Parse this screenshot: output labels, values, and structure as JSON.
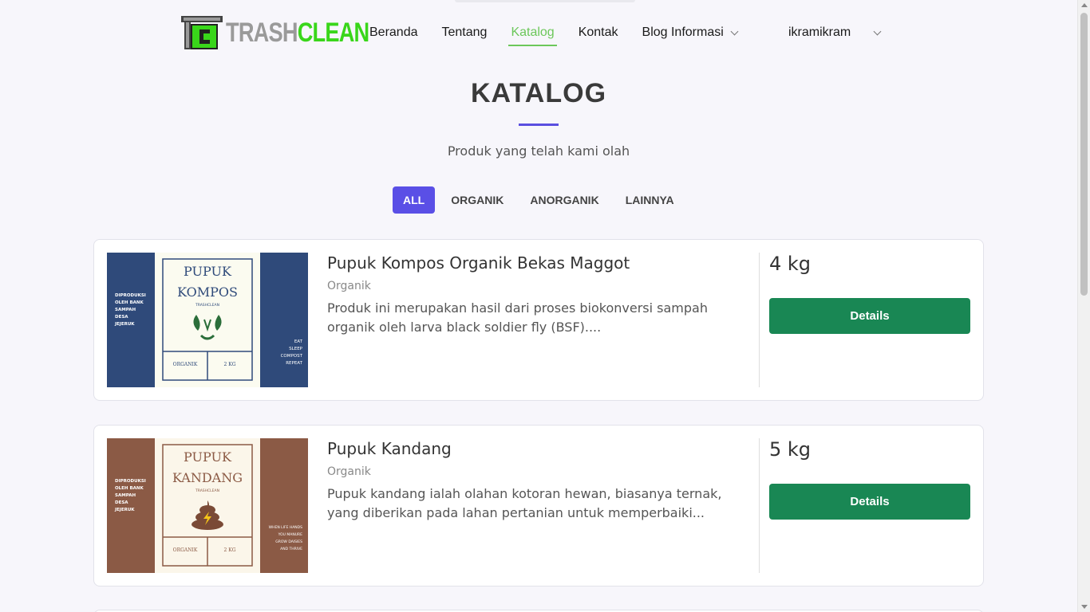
{
  "logo": {
    "text_part1": "TRASH",
    "text_part2": "CLEAN",
    "colors": {
      "part1": "#9a9a9a",
      "part2": "#39d61a"
    }
  },
  "nav": {
    "items": [
      {
        "label": "Beranda"
      },
      {
        "label": "Tentang"
      },
      {
        "label": "Katalog",
        "active": true
      },
      {
        "label": "Kontak"
      },
      {
        "label": "Blog Informasi",
        "dropdown": true
      }
    ],
    "user": {
      "name": "ikramikram"
    }
  },
  "page": {
    "title": "KATALOG",
    "subtitle": "Produk yang telah kami olah",
    "accent_color": "#5a4fe6"
  },
  "filters": [
    {
      "label": "ALL",
      "active": true
    },
    {
      "label": "ORGANIK"
    },
    {
      "label": "ANORGANIK"
    },
    {
      "label": "LAINNYA"
    }
  ],
  "products": [
    {
      "name": "Pupuk Kompos Organik Bekas Maggot",
      "category": "Organik",
      "description": "Produk ini merupakan hasil dari proses biokonversi sampah organik oleh larva black soldier fly (BSF)....",
      "weight": "4 kg",
      "button": "Details",
      "image": {
        "color": "#2f4a7a",
        "title1": "PUPUK",
        "title2": "KOMPOS",
        "brand": "TRASHCLEAN",
        "side_left": [
          "DIPRODUKSI",
          "OLEH BANK",
          "SAMPAH",
          "DESA",
          "JEJERUK"
        ],
        "side_right": [
          "EAT",
          "SLEEP",
          "COMPOST",
          "REPEAT"
        ],
        "footer_left": "ORGANIK",
        "footer_right": "2 KG",
        "icon": "leaf-recycle-icon"
      }
    },
    {
      "name": "Pupuk Kandang",
      "category": "Organik",
      "description": "Pupuk kandang ialah olahan kotoran hewan, biasanya ternak, yang diberikan pada lahan pertanian untuk memperbaiki...",
      "weight": "5 kg",
      "button": "Details",
      "image": {
        "color": "#8b5a45",
        "title1": "PUPUK",
        "title2": "KANDANG",
        "brand": "TRASHCLEAN",
        "side_left": [
          "DIPRODUKSI",
          "OLEH BANK",
          "SAMPAH",
          "DESA",
          "JEJERUK"
        ],
        "side_right": [
          "WHEN LIFE HANDS",
          "YOU MANURE",
          "GROW DAISIES",
          "AND THRIVE"
        ],
        "footer_left": "ORGANIK",
        "footer_right": "2 KG",
        "icon": "manure-icon"
      }
    }
  ],
  "colors": {
    "nav_active": "#6cc75a",
    "details_button": "#198754"
  }
}
